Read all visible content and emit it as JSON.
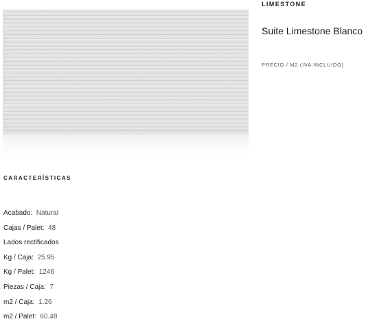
{
  "product": {
    "brand": "LIMESTONE",
    "title": "Suite Limestone Blanco",
    "price_label": "PRECIO / M2 (IVA INCLUIDO)",
    "image_description_color": "#e4e3e2"
  },
  "characteristics": {
    "heading": "CARACTERÍSTICAS",
    "items": [
      {
        "label": "Acabado:",
        "value": "Natural"
      },
      {
        "label": "Cajas / Palet:",
        "value": "48"
      },
      {
        "label": "Lados rectificados",
        "value": ""
      },
      {
        "label": "Kg / Caja:",
        "value": "25.95"
      },
      {
        "label": "Kg / Palet:",
        "value": "1246"
      },
      {
        "label": "Piezas / Caja:",
        "value": "7"
      },
      {
        "label": "m2 / Caja:",
        "value": "1.26"
      },
      {
        "label": "m2 / Palet:",
        "value": "60.48"
      }
    ]
  },
  "colors": {
    "tile_base": "#e4e3e2",
    "tile_groove": "#c9c8c6",
    "text_primary": "#222222",
    "text_secondary": "#555555"
  }
}
